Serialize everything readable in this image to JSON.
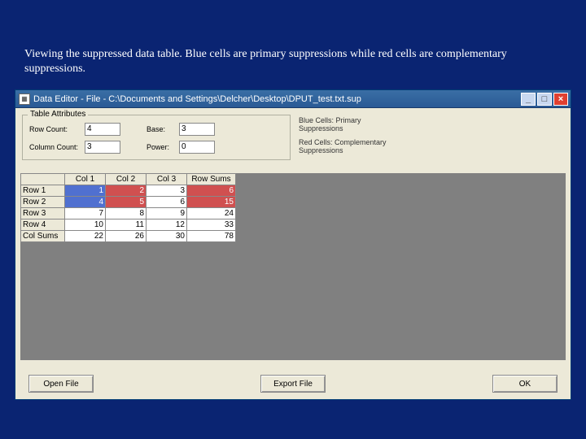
{
  "caption": "Viewing the suppressed data table. Blue cells are primary suppressions while red cells are complementary suppressions.",
  "window": {
    "title": "Data Editor - File - C:\\Documents and Settings\\Delcher\\Desktop\\DPUT_test.txt.sup",
    "min_tip": "_",
    "max_tip": "□",
    "close_tip": "×"
  },
  "attributes": {
    "legend": "Table Attributes",
    "row_count_label": "Row Count:",
    "row_count_value": "4",
    "col_count_label": "Column Count:",
    "col_count_value": "3",
    "base_label": "Base:",
    "base_value": "3",
    "power_label": "Power:",
    "power_value": "0"
  },
  "legend_text": {
    "blue": "Blue Cells: Primary Suppressions",
    "red": "Red Cells: Complementary Suppressions"
  },
  "table": {
    "corner": "",
    "col_headers": [
      "Col 1",
      "Col 2",
      "Col 3"
    ],
    "rowsum_header": "Row Sums",
    "rows": [
      {
        "head": "Row 1",
        "cells": [
          {
            "v": "1",
            "c": "blue"
          },
          {
            "v": "2",
            "c": "red"
          },
          {
            "v": "3",
            "c": ""
          }
        ],
        "sum": "6"
      },
      {
        "head": "Row 2",
        "cells": [
          {
            "v": "4",
            "c": "blue"
          },
          {
            "v": "5",
            "c": "red"
          },
          {
            "v": "6",
            "c": ""
          }
        ],
        "sum": "15"
      },
      {
        "head": "Row 3",
        "cells": [
          {
            "v": "7",
            "c": ""
          },
          {
            "v": "8",
            "c": ""
          },
          {
            "v": "9",
            "c": ""
          }
        ],
        "sum": "24"
      },
      {
        "head": "Row 4",
        "cells": [
          {
            "v": "10",
            "c": ""
          },
          {
            "v": "11",
            "c": ""
          },
          {
            "v": "12",
            "c": ""
          }
        ],
        "sum": "33"
      }
    ],
    "colsum_head": "Col Sums",
    "colsums": [
      "22",
      "26",
      "30"
    ],
    "grand": "78"
  },
  "buttons": {
    "open": "Open File",
    "export": "Export File",
    "ok": "OK"
  }
}
